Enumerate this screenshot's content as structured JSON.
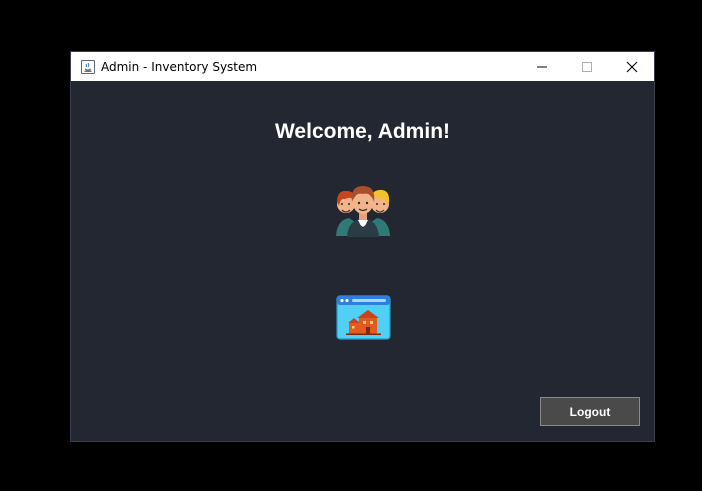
{
  "window": {
    "title": "Admin - Inventory System",
    "controls": {
      "minimize_icon": "minimize-icon",
      "maximize_icon": "maximize-icon",
      "close_icon": "close-icon"
    }
  },
  "main": {
    "welcome_text": "Welcome, Admin!",
    "users_icon": "users-group-icon",
    "inventory_icon": "inventory-store-icon"
  },
  "actions": {
    "logout_label": "Logout"
  },
  "colors": {
    "background": "#232732",
    "button_bg": "#4a4a4a",
    "button_border": "#8a8a8a"
  }
}
